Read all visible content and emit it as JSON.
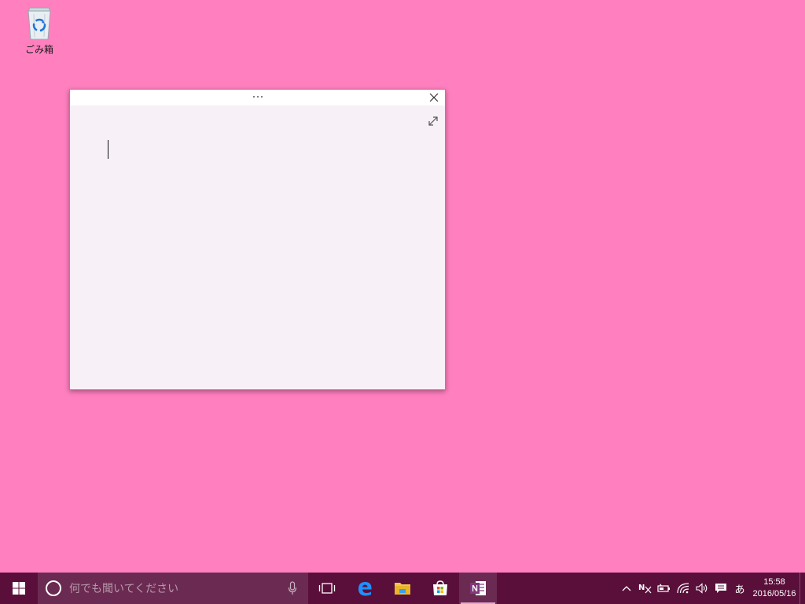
{
  "desktop": {
    "background_color": "#ff7fbf",
    "icons": [
      {
        "label": "ごみ箱",
        "icon": "recycle-bin-icon"
      }
    ]
  },
  "sticky_note": {
    "title_menu_icon": "ellipsis-icon",
    "close_icon": "close-icon",
    "expand_icon": "expand-icon",
    "content": "",
    "background_color": "#f7f1f7"
  },
  "taskbar": {
    "background_color": "#5a0f3a",
    "start_icon": "windows-start-icon",
    "search": {
      "placeholder": "何でも聞いてください",
      "cortana_icon": "cortana-circle-icon",
      "mic_icon": "microphone-icon"
    },
    "task_view_icon": "task-view-icon",
    "apps": [
      {
        "name": "edge",
        "icon": "edge-icon"
      },
      {
        "name": "file-explorer",
        "icon": "folder-icon"
      },
      {
        "name": "store",
        "icon": "store-icon"
      },
      {
        "name": "onenote",
        "icon": "onenote-icon",
        "active": true
      }
    ],
    "tray": {
      "chevron_icon": "chevron-up-icon",
      "network_activity_icon": "network-n-icon",
      "battery_icon": "battery-icon",
      "wifi_icon": "wifi-icon",
      "volume_icon": "volume-icon",
      "notification_icon": "action-center-icon",
      "ime_label": "あ",
      "time": "15:58",
      "date": "2016/05/16"
    }
  }
}
